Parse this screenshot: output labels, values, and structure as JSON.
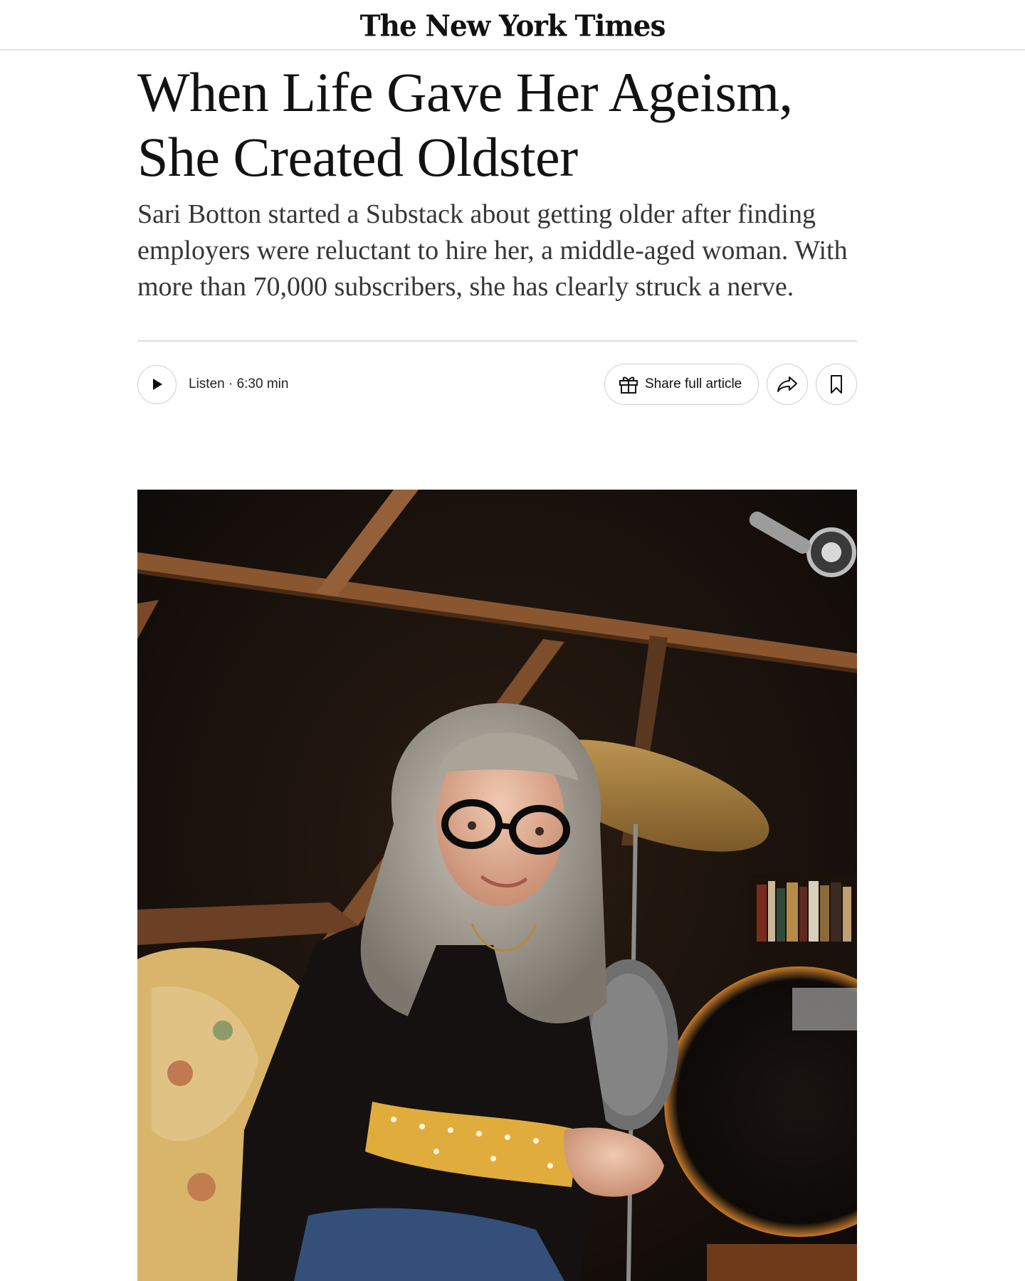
{
  "masthead": {
    "logo_text": "The New York Times"
  },
  "article": {
    "headline_line1": "When Life Gave Her Ageism,",
    "headline_line2": "She Created Oldster",
    "summary": "Sari Botton started a Substack about getting older after finding employers were reluctant to hire her, a middle-aged woman. With more than 70,000 subscribers, she has clearly struck a nerve."
  },
  "toolbar": {
    "listen_label": "Listen · 6:30 min",
    "share_full_label": "Share full article",
    "icons": {
      "play": "play-icon",
      "gift": "gift-icon",
      "share": "share-arrow-icon",
      "bookmark": "bookmark-icon"
    }
  },
  "photo": {
    "subject": "Portrait of a woman with gray hair and glasses seated in a studio with drums"
  }
}
